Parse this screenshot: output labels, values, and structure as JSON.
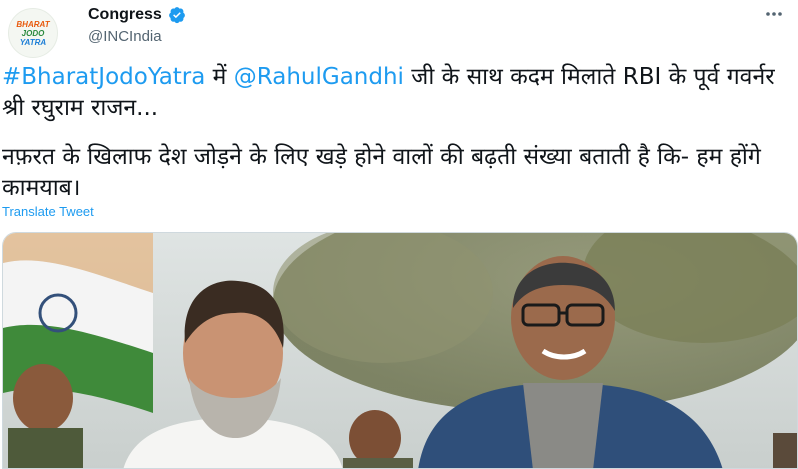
{
  "tweet": {
    "author": {
      "display_name": "Congress",
      "handle": "@INCIndia",
      "avatar_logo_lines": [
        "BHARAT",
        "JODO",
        "YATRA"
      ],
      "verified": true
    },
    "more_icon": "more-horizontal-icon",
    "text": {
      "line1_hashtag": "#BharatJodoYatra",
      "line1_mid": " में ",
      "line1_mention": "@RahulGandhi",
      "line1_rest": " जी के साथ कदम मिलाते RBI के पूर्व गवर्नर श्री रघुराम राजन...",
      "paragraph2": "नफ़रत के खिलाफ देश जोड़ने के लिए खड़े होने वालों की बढ़ती संख्या बताती है कि- हम होंगे कामयाब।"
    },
    "translate_label": "Translate Tweet",
    "media": {
      "type": "photo"
    }
  },
  "colors": {
    "link": "#1d9bf0",
    "text": "#0f1419",
    "secondary": "#536471",
    "verified_badge": "#1d9bf0"
  }
}
